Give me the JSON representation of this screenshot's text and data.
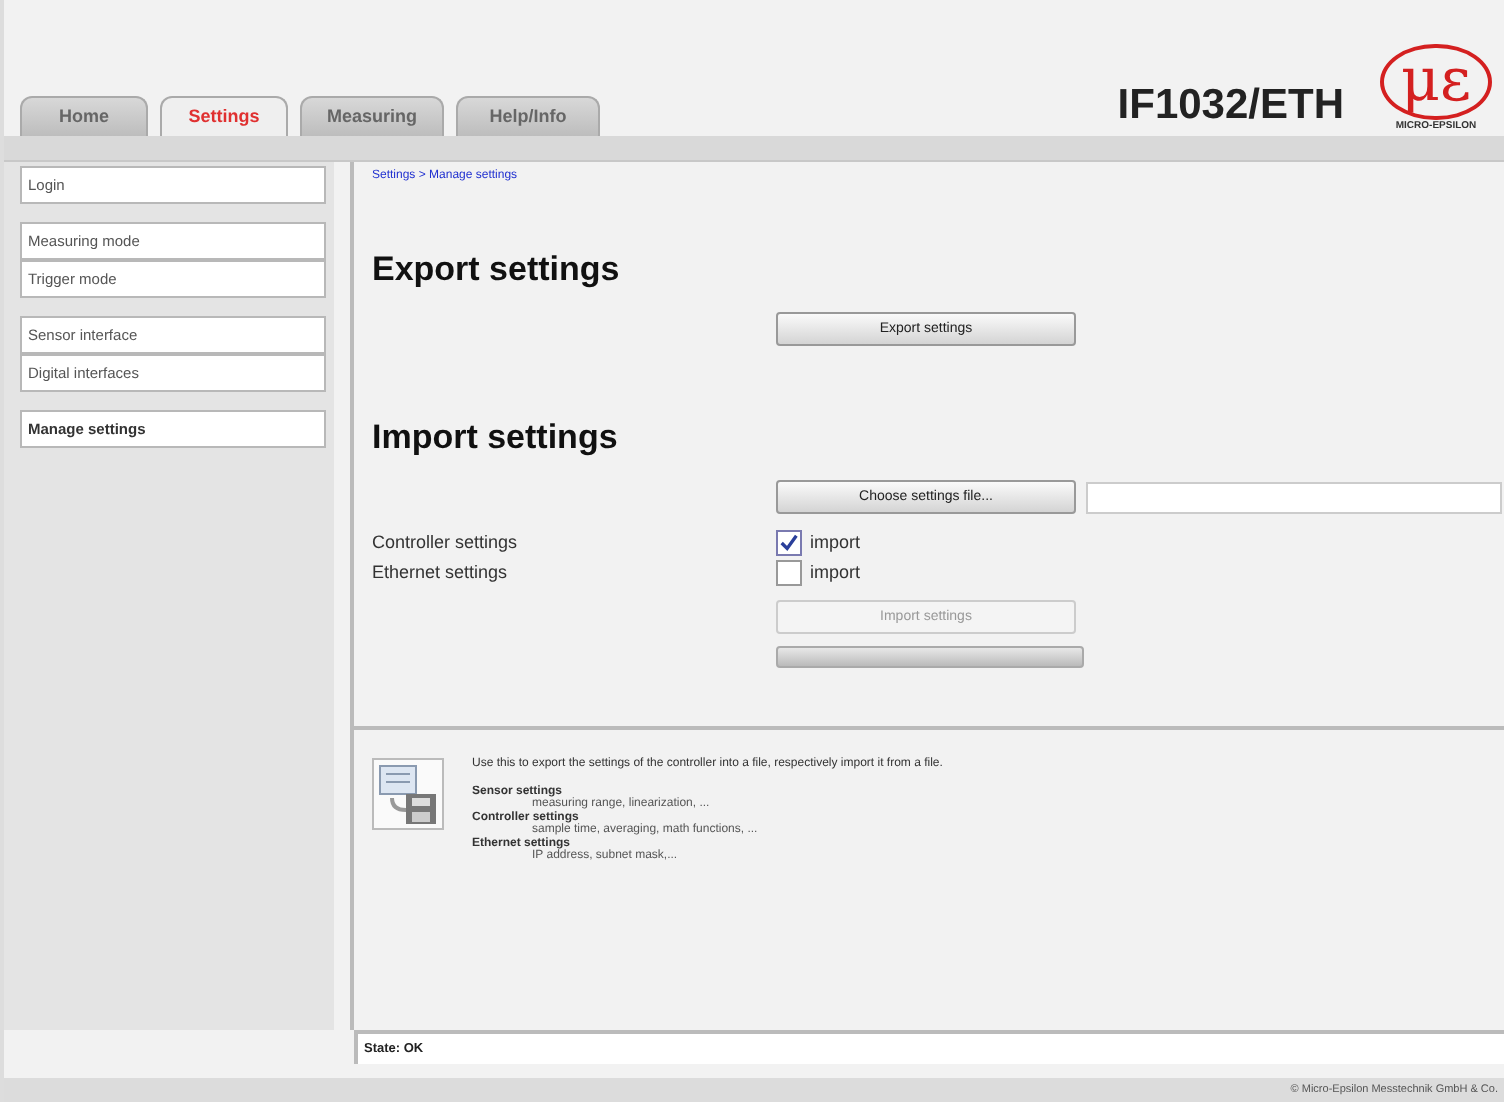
{
  "header": {
    "title": "IF1032/ETH",
    "logo_mark": "με",
    "logo_text": "MICRO-EPSILON"
  },
  "tabs": [
    {
      "label": "Home",
      "selected": false
    },
    {
      "label": "Settings",
      "selected": true
    },
    {
      "label": "Measuring",
      "selected": false
    },
    {
      "label": "Help/Info",
      "selected": false
    }
  ],
  "sidebar": {
    "groups": [
      {
        "items": [
          {
            "label": "Login",
            "selected": false
          }
        ]
      },
      {
        "items": [
          {
            "label": "Measuring mode",
            "selected": false
          },
          {
            "label": "Trigger mode",
            "selected": false
          }
        ]
      },
      {
        "items": [
          {
            "label": "Sensor interface",
            "selected": false
          },
          {
            "label": "Digital interfaces",
            "selected": false
          }
        ]
      },
      {
        "items": [
          {
            "label": "Manage settings",
            "selected": true
          }
        ]
      }
    ]
  },
  "breadcrumb": "Settings > Manage settings",
  "export": {
    "heading": "Export settings",
    "button": "Export settings"
  },
  "import": {
    "heading": "Import settings",
    "choose_button": "Choose settings file...",
    "options": [
      {
        "label": "Controller settings",
        "checkbox_label": "import",
        "checked": true
      },
      {
        "label": "Ethernet settings",
        "checkbox_label": "import",
        "checked": false
      }
    ],
    "import_button": {
      "label": "Import settings",
      "disabled": true
    },
    "progress": {
      "level": 0
    }
  },
  "help": {
    "intro": "Use this to export the settings of the controller into a file, respectively import it from a file.",
    "sections": [
      {
        "title": "Sensor settings",
        "detail": "measuring range, linearization, ..."
      },
      {
        "title": "Controller settings",
        "detail": "sample time, averaging, math functions, ..."
      },
      {
        "title": "Ethernet settings",
        "detail": "IP address, subnet mask,..."
      }
    ]
  },
  "status_bar": "State: OK",
  "footer": "© Micro-Epsilon Messtechnik GmbH & Co."
}
